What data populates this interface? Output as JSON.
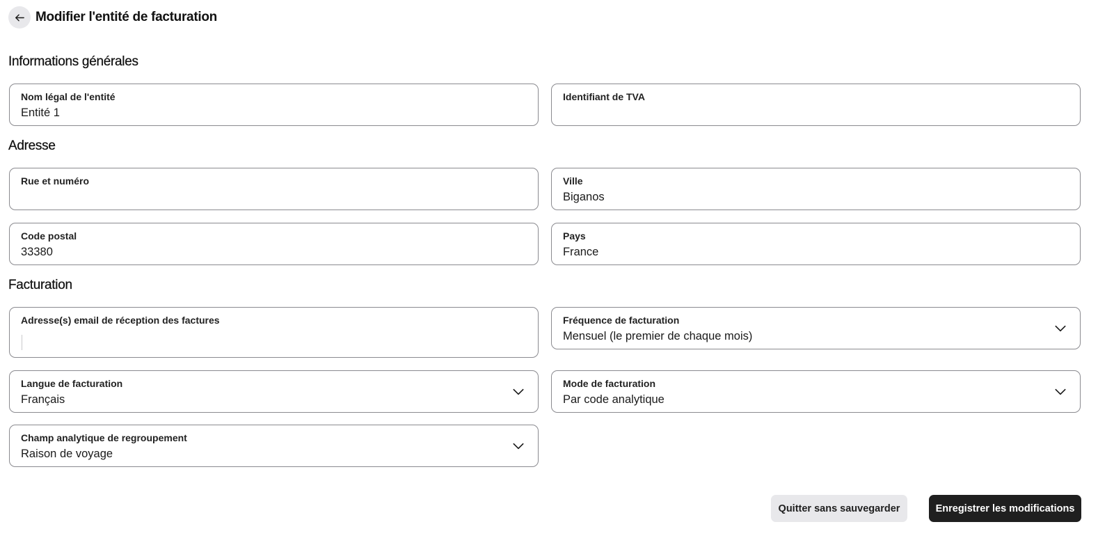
{
  "header": {
    "title": "Modifier l'entité de facturation",
    "back_icon": "arrow-left-icon"
  },
  "sections": {
    "general": "Informations générales",
    "address": "Adresse",
    "billing": "Facturation"
  },
  "fields": {
    "legal_name": {
      "label": "Nom légal de l'entité",
      "value": "Entité 1"
    },
    "vat_id": {
      "label": "Identifiant de TVA",
      "value": ""
    },
    "street": {
      "label": "Rue et numéro",
      "value": ""
    },
    "city": {
      "label": "Ville",
      "value": "Biganos"
    },
    "postal_code": {
      "label": "Code postal",
      "value": "33380"
    },
    "country": {
      "label": "Pays",
      "value": "France"
    },
    "invoice_emails": {
      "label": "Adresse(s) email de réception des factures",
      "value": ""
    },
    "billing_frequency": {
      "label": "Fréquence de facturation",
      "value": "Mensuel (le premier de chaque mois)"
    },
    "billing_language": {
      "label": "Langue de facturation",
      "value": "Français"
    },
    "billing_mode": {
      "label": "Mode de facturation",
      "value": "Par code analytique"
    },
    "grouping_field": {
      "label": "Champ analytique de regroupement",
      "value": "Raison de voyage"
    }
  },
  "actions": {
    "quit_label": "Quitter sans sauvegarder",
    "save_label": "Enregistrer les modifications"
  },
  "colors": {
    "primary_button": "#1f1f1f",
    "secondary_button": "#e8e8eb",
    "field_border": "#8a8a8f"
  }
}
